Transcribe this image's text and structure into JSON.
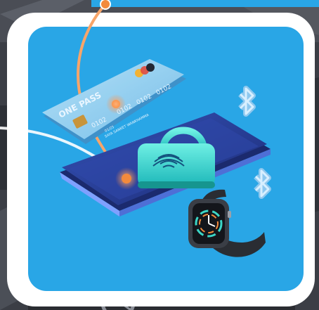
{
  "card": {
    "brand": "ONE PASS",
    "number_part_1": "0102",
    "number_part_2": "0102",
    "number_part_3": "0102",
    "number_part_4": "0102",
    "expiry": "01/25",
    "holder": "SAYA SANKET WANKHAMMA"
  },
  "icons": [
    "bluetooth-icon",
    "bluetooth-icon",
    "fingerprint-icon",
    "padlock-icon",
    "smartwatch-icon",
    "credit-card-icon",
    "smartphone-icon"
  ],
  "colors": {
    "panel_blue": "#29a6e6",
    "frame_white": "#ffffff",
    "accent_orange": "#f28a3c",
    "card_blue": "#8fd0f2",
    "phone_navy": "#2b3f9a",
    "lock_teal": "#34d6c8",
    "bluetooth_blue": "#8ec8ef",
    "watch_black": "#2a2d33"
  }
}
